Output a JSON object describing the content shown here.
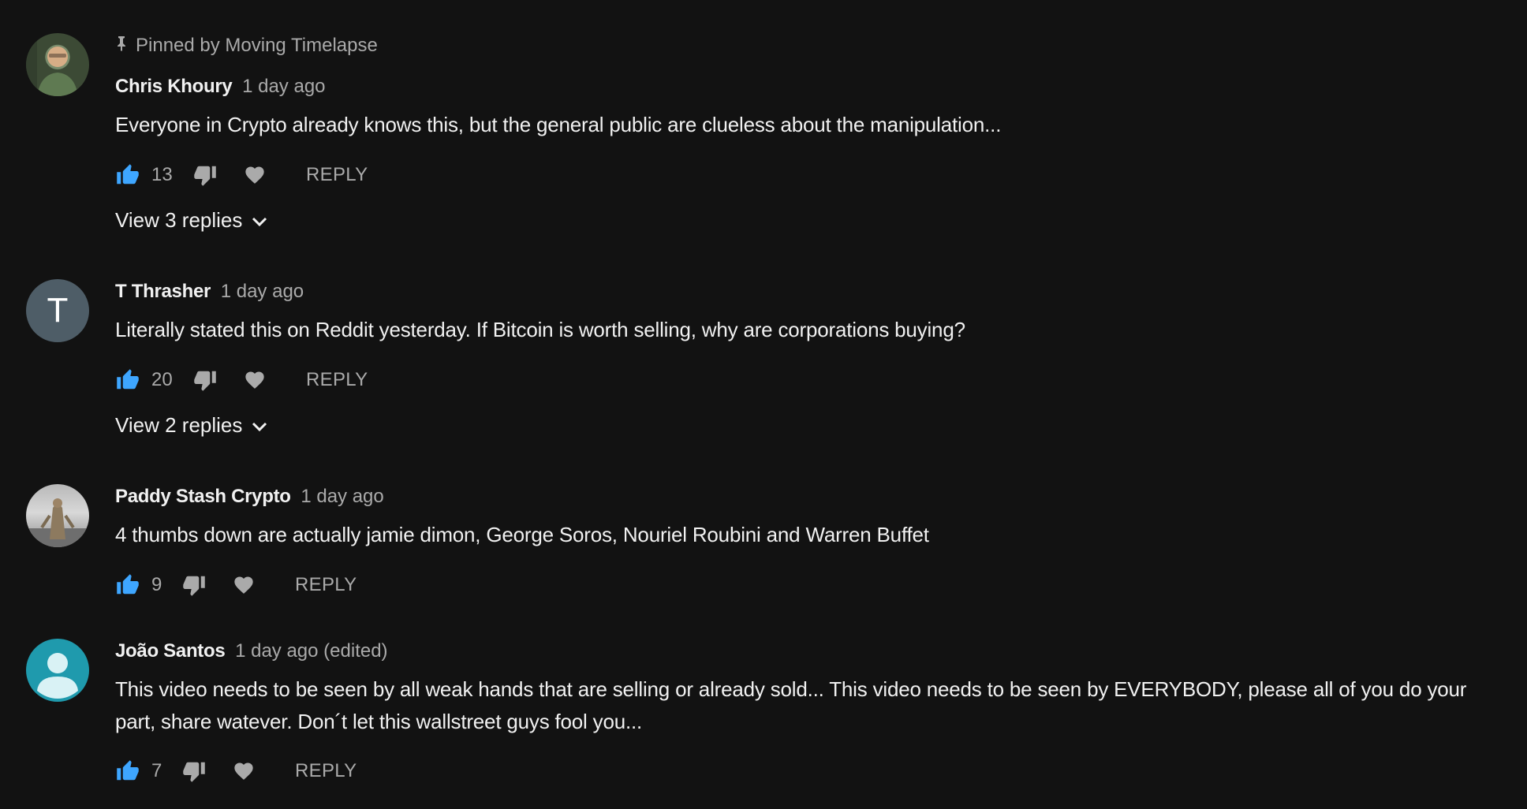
{
  "comments": [
    {
      "pinned_label": "Pinned by Moving Timelapse",
      "author": "Chris Khoury",
      "time": "1 day ago",
      "text": "Everyone in Crypto already knows this, but the general public are clueless about the manipulation...",
      "likes": "13",
      "reply_label": "REPLY",
      "view_replies": "View 3 replies",
      "avatar": "photo"
    },
    {
      "author": "T Thrasher",
      "time": "1 day ago",
      "text": "Literally stated this on Reddit yesterday. If Bitcoin is worth selling, why are corporations buying?",
      "likes": "20",
      "reply_label": "REPLY",
      "view_replies": "View 2 replies",
      "avatar_letter": "T"
    },
    {
      "author": "Paddy Stash Crypto",
      "time": "1 day ago",
      "text": "4 thumbs down are actually jamie dimon, George Soros, Nouriel Roubini and Warren Buffet",
      "likes": "9",
      "reply_label": "REPLY",
      "avatar": "photo"
    },
    {
      "author": "João Santos",
      "time": "1 day ago (edited)",
      "text": "This video needs to be seen by all weak hands that are selling or already sold... This video needs to be seen by EVERYBODY, please all of you do your part, share watever. Don´t let this wallstreet guys fool you...",
      "likes": "7",
      "reply_label": "REPLY",
      "avatar": "default-person"
    }
  ],
  "icons": {
    "like": "thumbs-up-icon",
    "dislike": "thumbs-down-icon",
    "heart": "heart-icon",
    "pin": "pin-icon",
    "chevron": "chevron-down-icon"
  },
  "colors": {
    "background": "#121212",
    "like_active": "#3ea6ff",
    "muted": "#aaaaaa",
    "text": "#f1f1f1"
  }
}
